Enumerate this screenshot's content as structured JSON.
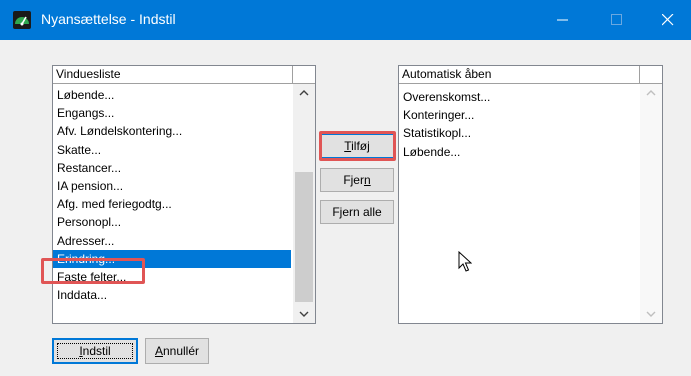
{
  "window": {
    "title": "Nyansættelse - Indstil",
    "titlebar_color": "#0078d7",
    "icons": {
      "app": "gauge-icon",
      "minimize": "minimize-icon",
      "maximize": "maximize-icon",
      "close": "close-icon"
    }
  },
  "left_list": {
    "header": "Vinduesliste",
    "items": [
      "Løbende...",
      "Engangs...",
      "Afv. Løndelskontering...",
      "Skatte...",
      "Restancer...",
      "IA pension...",
      "Afg. med feriegodtg...",
      "Personopl...",
      "Adresser...",
      "Erindring...",
      "Faste felter...",
      "Inddata..."
    ],
    "selected": "Erindring...",
    "selection_color": "#0078d7"
  },
  "right_list": {
    "header": "Automatisk åben",
    "items": [
      "Overenskomst...",
      "Konteringer...",
      "Statistikopl...",
      "Løbende..."
    ]
  },
  "buttons": {
    "add": {
      "underlined": "T",
      "rest": "ilføj"
    },
    "remove": {
      "pre": "Fjer",
      "underlined": "n",
      "rest": ""
    },
    "remove_all": {
      "pre": "F",
      "underlined": "j",
      "rest": "ern alle"
    },
    "ok": {
      "underlined": "I",
      "rest": "ndstil"
    },
    "cancel": {
      "underlined": "A",
      "rest": "nnullér"
    }
  },
  "highlight_color": "#e05555"
}
